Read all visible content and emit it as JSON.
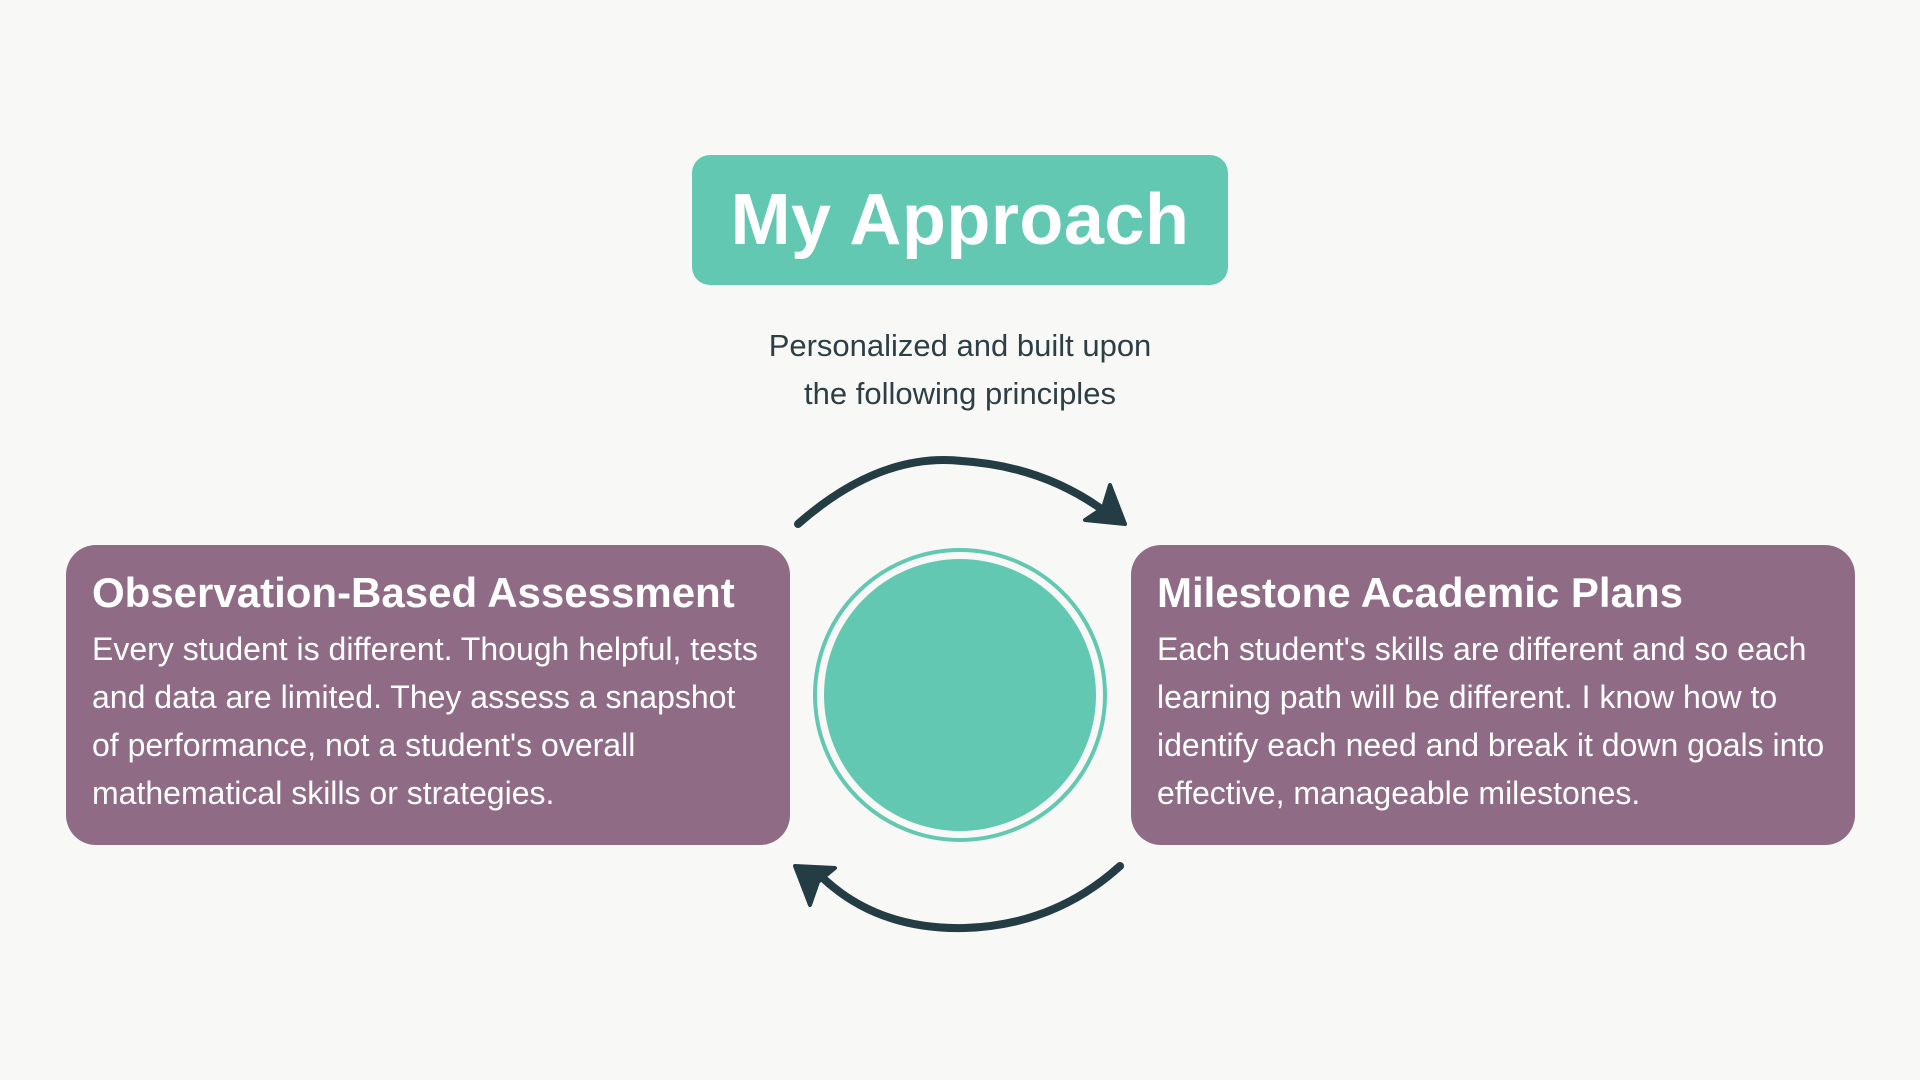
{
  "title": "My Approach",
  "subtitle": {
    "line1": "Personalized and built upon",
    "line2": "the following principles"
  },
  "cards": {
    "left": {
      "heading": "Observation-Based Assessment",
      "body": "Every student is different. Though helpful, tests and data are limited. They assess a snapshot of performance, not a student's overall mathematical skills or strategies."
    },
    "right": {
      "heading": "Milestone Academic Plans",
      "body": "Each student's skills are different and so each learning path will be different. I know how to identify each need and break it down goals into effective, manageable milestones."
    }
  },
  "colors": {
    "background": "#f8f8f6",
    "accent_teal": "#63c8b2",
    "card_purple": "#8f6b86",
    "arrow_dark": "#243c44",
    "text_dark": "#2d3e45"
  },
  "icons": {
    "top_arrow": "curved-arrow-right-icon",
    "bottom_arrow": "curved-arrow-left-icon",
    "center": "teal-circle"
  }
}
